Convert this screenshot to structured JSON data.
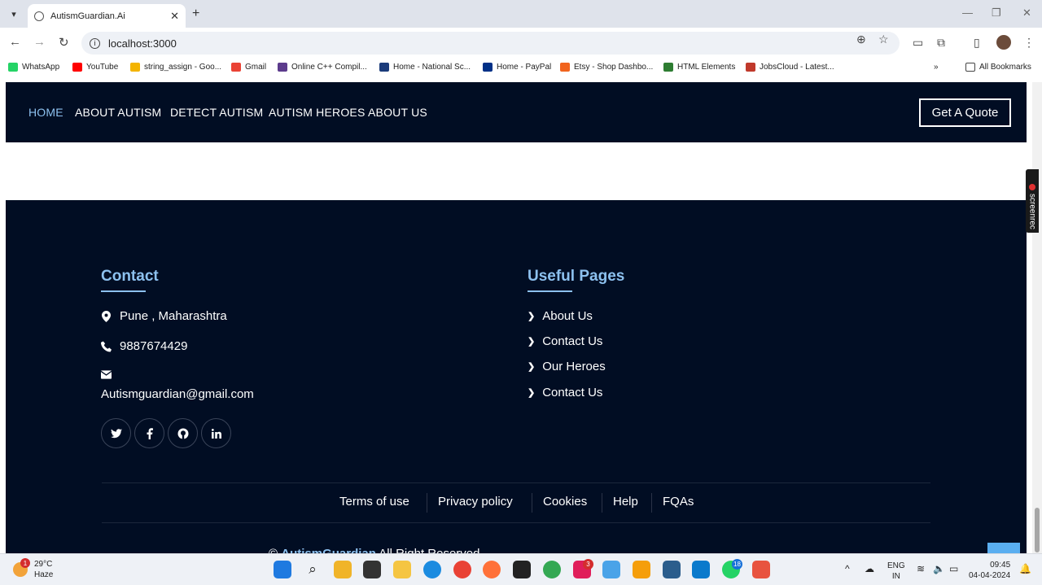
{
  "browser": {
    "tab_title": "AutismGuardian.Ai",
    "url": "localhost:3000",
    "bookmarks": [
      {
        "label": "WhatsApp",
        "color": "#25d366"
      },
      {
        "label": "YouTube",
        "color": "#ff0000"
      },
      {
        "label": "string_assign - Goo...",
        "color": "#f4b400"
      },
      {
        "label": "Gmail",
        "color": "#ea4335"
      },
      {
        "label": "Online C++ Compil...",
        "color": "#5c3b8c"
      },
      {
        "label": "Home - National Sc...",
        "color": "#1b3b7a"
      },
      {
        "label": "Home - PayPal",
        "color": "#003087"
      },
      {
        "label": "Etsy - Shop Dashbo...",
        "color": "#f1641e"
      },
      {
        "label": "HTML Elements",
        "color": "#2e7d32"
      },
      {
        "label": "JobsCloud - Latest...",
        "color": "#c0392b"
      }
    ],
    "all_bookmarks": "All Bookmarks"
  },
  "navbar": {
    "items": [
      "HOME",
      "ABOUT AUTISM",
      "DETECT AUTISM",
      "AUTISM HEROES",
      "ABOUT US"
    ],
    "cta": "Get A Quote",
    "active_color": "#8dc1ef"
  },
  "footer": {
    "contact": {
      "title": "Contact",
      "location": "Pune , Maharashtra",
      "phone": "9887674429",
      "email": "Autismguardian@gmail.com"
    },
    "useful": {
      "title": "Useful Pages",
      "links": [
        "About Us",
        "Contact Us",
        "Our Heroes",
        "Contact Us"
      ]
    },
    "social": [
      "twitter-icon",
      "facebook-icon",
      "github-icon",
      "linkedin-icon"
    ],
    "bottom_links": [
      "Terms of use",
      "Privacy policy",
      "Cookies",
      "Help",
      "FQAs"
    ],
    "copyright_prefix": "©",
    "copyright_brand": "AutismGuardian",
    "copyright_suffix": "All Right Reserved."
  },
  "screenrec": "screenrec",
  "taskbar": {
    "temperature": "29°C",
    "condition": "Haze",
    "weather_badge": "1",
    "lang_top": "ENG",
    "lang_bottom": "IN",
    "time": "09:45",
    "date": "04-04-2024",
    "badge_chrome": "3",
    "badge_whatsapp": "18"
  }
}
